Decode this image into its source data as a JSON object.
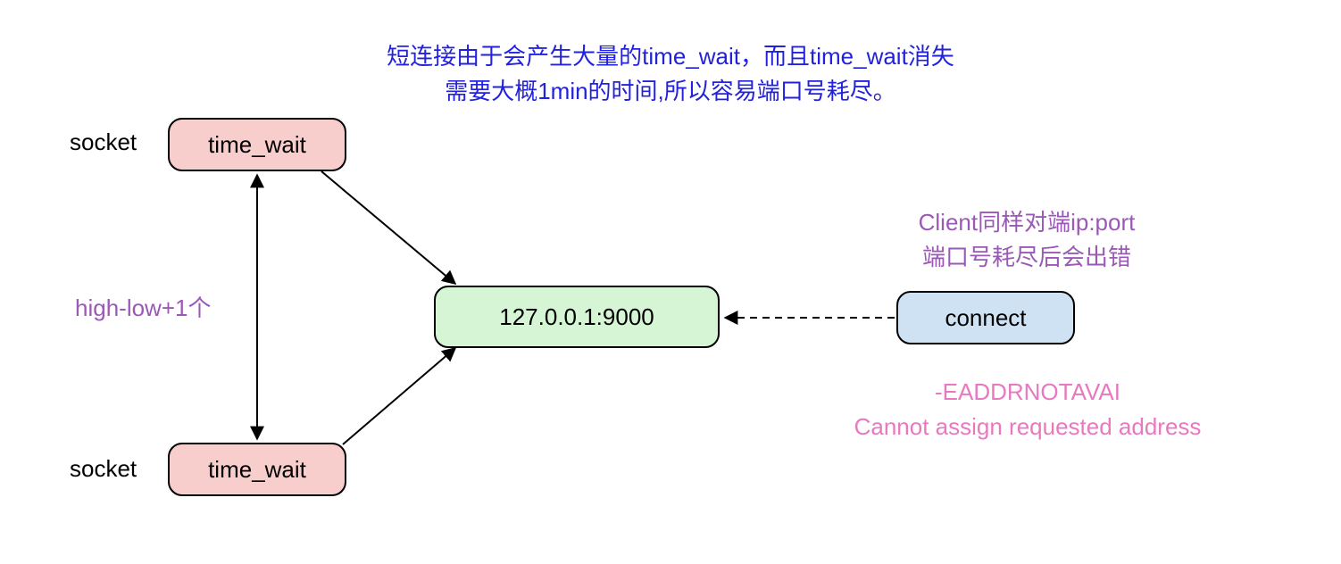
{
  "title_line1": "短连接由于会产生大量的time_wait，而且time_wait消失",
  "title_line2": "需要大概1min的时间,所以容易端口号耗尽。",
  "socket_label_top": "socket",
  "socket_label_bottom": "socket",
  "timewait_top": "time_wait",
  "timewait_bottom": "time_wait",
  "highlow_label": "high-low+1个",
  "server_addr": "127.0.0.1:9000",
  "connect_label": "connect",
  "client_note_line1": "Client同样对端ip:port",
  "client_note_line2": "端口号耗尽后会出错",
  "error_line1": "-EADDRNOTAVAI",
  "error_line2": "Cannot assign requested address",
  "colors": {
    "title": "#2222dd",
    "purple": "#9b59b6",
    "pink_text": "#e879c0",
    "pink_fill": "#f8cecc",
    "green_fill": "#d5f5d5",
    "blue_fill": "#cfe2f3",
    "stroke": "#000000"
  }
}
